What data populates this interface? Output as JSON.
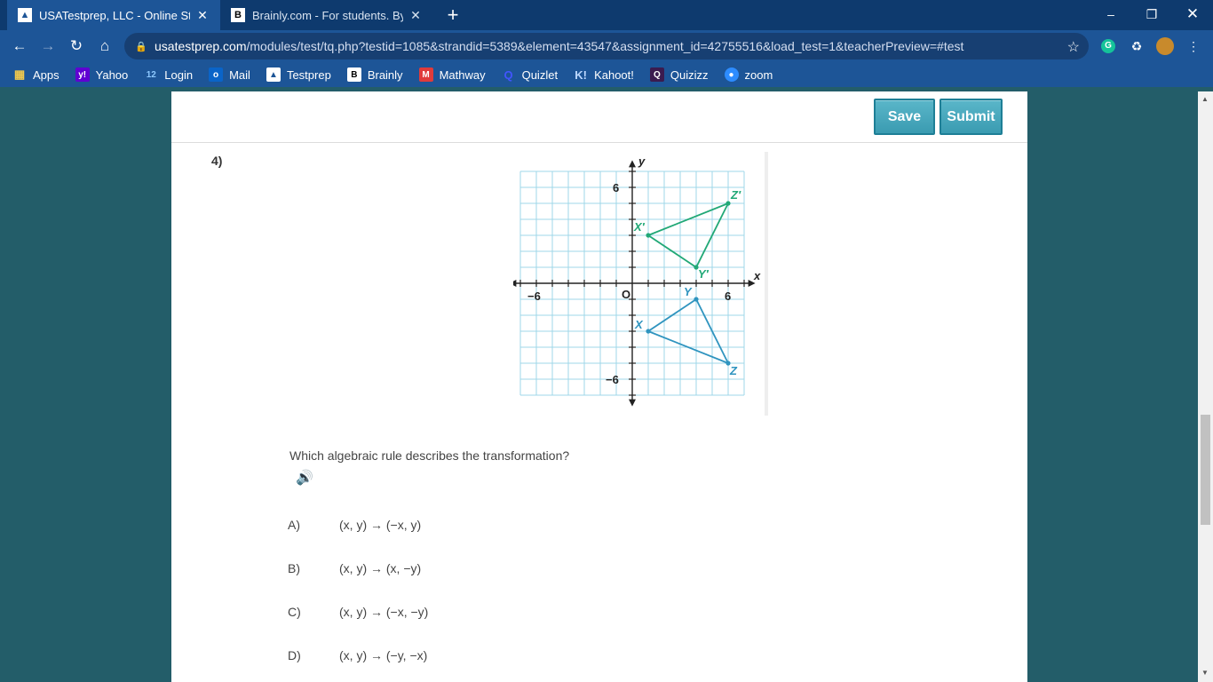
{
  "browser": {
    "tabs": [
      {
        "title": "USATestprep, LLC - Online State-",
        "active": true,
        "icon": "usatestprep-favicon"
      },
      {
        "title": "Brainly.com - For students. By stu",
        "active": false,
        "icon": "brainly-favicon"
      }
    ],
    "url_host": "usatestprep.com",
    "url_path": "/modules/test/tq.php?testid=1085&strandid=5389&element=43547&assignment_id=42755516&load_test=1&teacherPreview=#test",
    "bookmarks": [
      {
        "label": "Apps",
        "icon": "apps-grid-icon"
      },
      {
        "label": "Yahoo",
        "icon": "yahoo-icon"
      },
      {
        "label": "Login",
        "icon": "login-icon"
      },
      {
        "label": "Mail",
        "icon": "outlook-icon"
      },
      {
        "label": "Testprep",
        "icon": "testprep-icon"
      },
      {
        "label": "Brainly",
        "icon": "brainly-icon"
      },
      {
        "label": "Mathway",
        "icon": "mathway-icon"
      },
      {
        "label": "Quizlet",
        "icon": "quizlet-icon"
      },
      {
        "label": "Kahoot!",
        "icon": "kahoot-icon"
      },
      {
        "label": "Quizizz",
        "icon": "quizizz-icon"
      },
      {
        "label": "zoom",
        "icon": "zoom-icon"
      }
    ],
    "colors": {
      "tab_strip": "#0e3a6e",
      "toolbar": "#1d5597",
      "page_bg": "#235d69"
    }
  },
  "toolbar": {
    "save_label": "Save",
    "submit_label": "Submit"
  },
  "question": {
    "number": "4)",
    "text": "Which algebraic rule describes the transformation?",
    "options": [
      {
        "letter": "A)",
        "text": "(x, y) → (−x, y)"
      },
      {
        "letter": "B)",
        "text": "(x, y) → (x, −y)"
      },
      {
        "letter": "C)",
        "text": "(x, y) → (−x, −y)"
      },
      {
        "letter": "D)",
        "text": "(x, y) → (−y, −x)"
      }
    ]
  },
  "graph": {
    "axis_x_label": "x",
    "axis_y_label": "y",
    "origin_label": "O",
    "tick_labels": {
      "x_neg": "−6",
      "x_pos": "6",
      "y_pos": "6",
      "y_neg": "−6"
    },
    "range": {
      "x": [
        -7,
        7
      ],
      "y": [
        -7,
        7
      ]
    },
    "grid_color": "#9fd7e8",
    "triangles": [
      {
        "name": "image",
        "color": "#21a876",
        "points": [
          {
            "label": "X′",
            "x": 1,
            "y": 3
          },
          {
            "label": "Y′",
            "x": 4,
            "y": 1
          },
          {
            "label": "Z′",
            "x": 6,
            "y": 5
          }
        ]
      },
      {
        "name": "preimage",
        "color": "#2f94bf",
        "points": [
          {
            "label": "X",
            "x": 1,
            "y": -3
          },
          {
            "label": "Y",
            "x": 4,
            "y": -1
          },
          {
            "label": "Z",
            "x": 6,
            "y": -5
          }
        ]
      }
    ]
  }
}
